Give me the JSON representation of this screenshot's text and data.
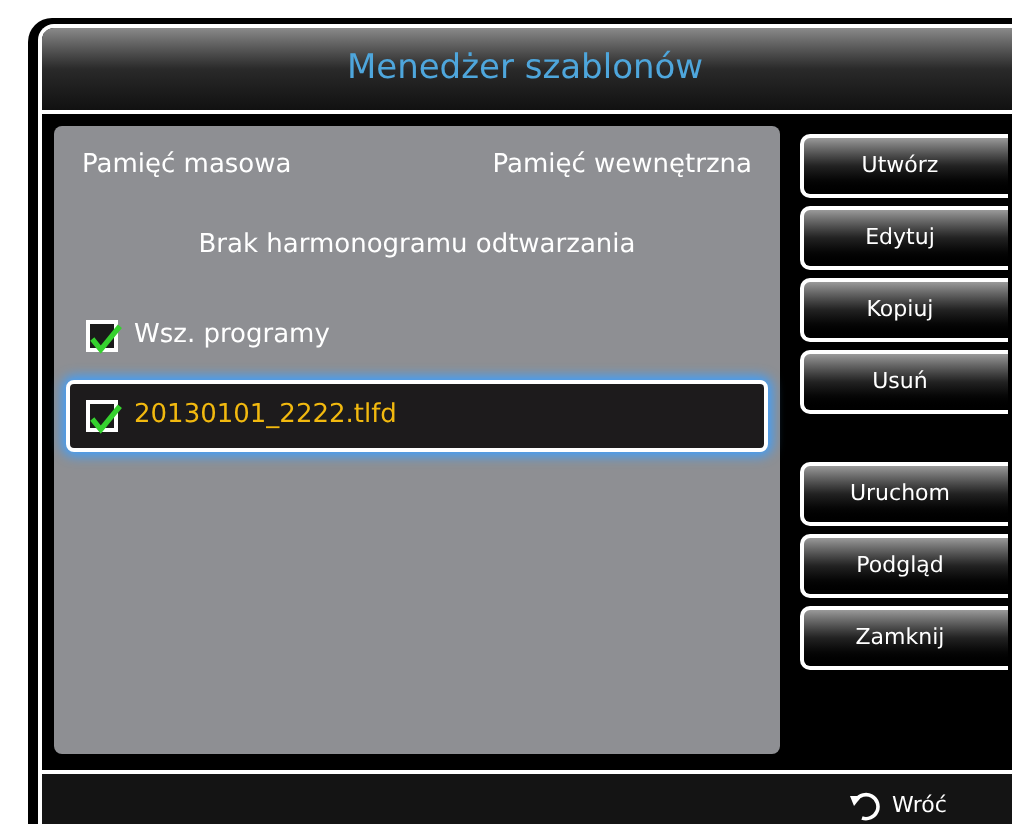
{
  "window": {
    "title": "Menedżer szablonów"
  },
  "storage_options": [
    "Pamięć masowa",
    "Pamięć wewnętrzna"
  ],
  "status_message": "Brak harmonogramu odtwarzania",
  "items": [
    {
      "label": "Wsz. programy",
      "checked": true,
      "selected": false
    },
    {
      "label": "20130101_2222.tlfd",
      "checked": true,
      "selected": true
    }
  ],
  "button_groups": [
    [
      "Utwórz",
      "Edytuj",
      "Kopiuj",
      "Usuń"
    ],
    [
      "Uruchom",
      "Podgląd",
      "Zamknij"
    ]
  ],
  "footer": {
    "back_label": "Wróć"
  }
}
